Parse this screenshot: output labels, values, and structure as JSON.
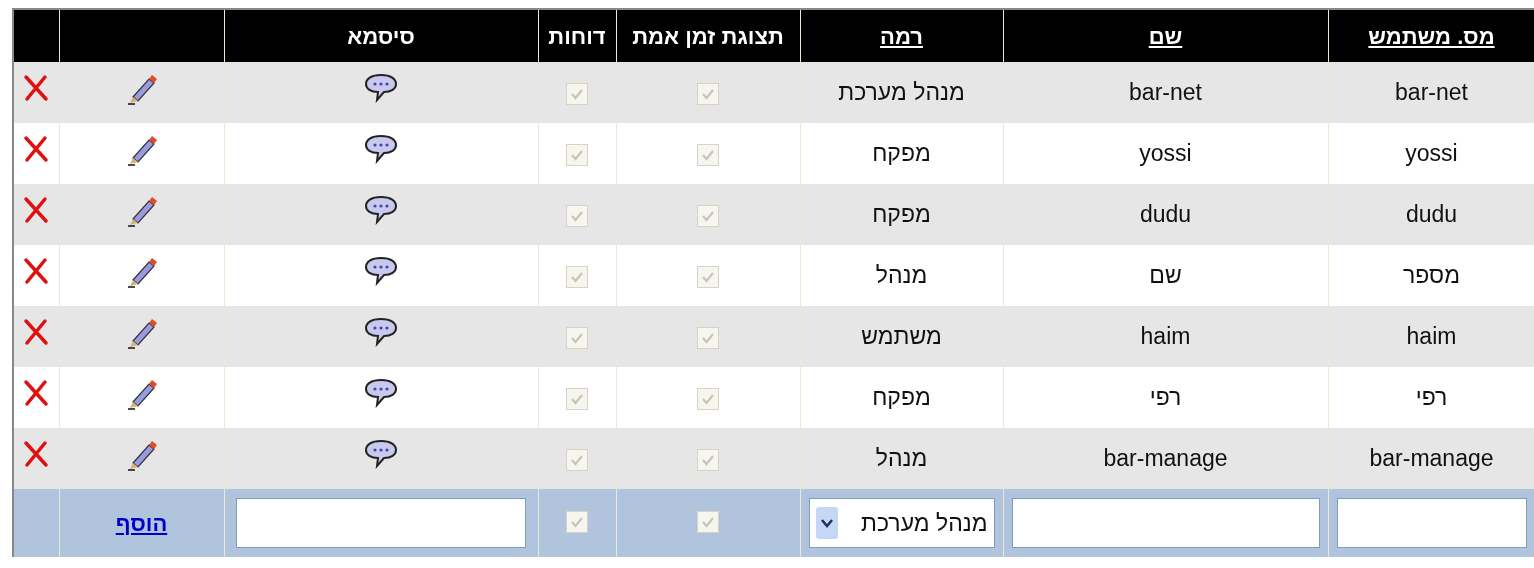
{
  "table": {
    "columns": [
      {
        "label": "מס. משתמש",
        "sortable": true
      },
      {
        "label": "שם",
        "sortable": true
      },
      {
        "label": "רמה",
        "sortable": true
      },
      {
        "label": "תצוגת זמן אמת",
        "sortable": false
      },
      {
        "label": "דוחות",
        "sortable": false
      },
      {
        "label": "סיסמא",
        "sortable": false
      }
    ],
    "rows": [
      {
        "user": "bar-net",
        "name": "bar-net",
        "level": "מנהל מערכת",
        "realtime": {
          "checked": true,
          "disabled": true
        },
        "reports": {
          "checked": true,
          "disabled": true
        }
      },
      {
        "user": "yossi",
        "name": "yossi",
        "level": "מפקח",
        "realtime": {
          "checked": true,
          "disabled": true
        },
        "reports": {
          "checked": true,
          "disabled": true
        }
      },
      {
        "user": "dudu",
        "name": "dudu",
        "level": "מפקח",
        "realtime": {
          "checked": true,
          "disabled": true
        },
        "reports": {
          "checked": true,
          "disabled": true
        }
      },
      {
        "user": "מספר",
        "name": "שם",
        "level": "מנהל",
        "realtime": {
          "checked": true,
          "disabled": true
        },
        "reports": {
          "checked": true,
          "disabled": true
        }
      },
      {
        "user": "haim",
        "name": "haim",
        "level": "משתמש",
        "realtime": {
          "checked": true,
          "disabled": true
        },
        "reports": {
          "checked": true,
          "disabled": true
        }
      },
      {
        "user": "רפי",
        "name": "רפי",
        "level": "מפקח",
        "realtime": {
          "checked": true,
          "disabled": true
        },
        "reports": {
          "checked": true,
          "disabled": true
        }
      },
      {
        "user": "bar-manage",
        "name": "bar-manage",
        "level": "מנהל",
        "realtime": {
          "checked": true,
          "disabled": true
        },
        "reports": {
          "checked": true,
          "disabled": true
        }
      }
    ],
    "add_row": {
      "level_value": "מנהל מערכת",
      "realtime": {
        "checked": true,
        "disabled": true
      },
      "reports": {
        "checked": true,
        "disabled": true
      },
      "add_link": "הוסף"
    }
  }
}
